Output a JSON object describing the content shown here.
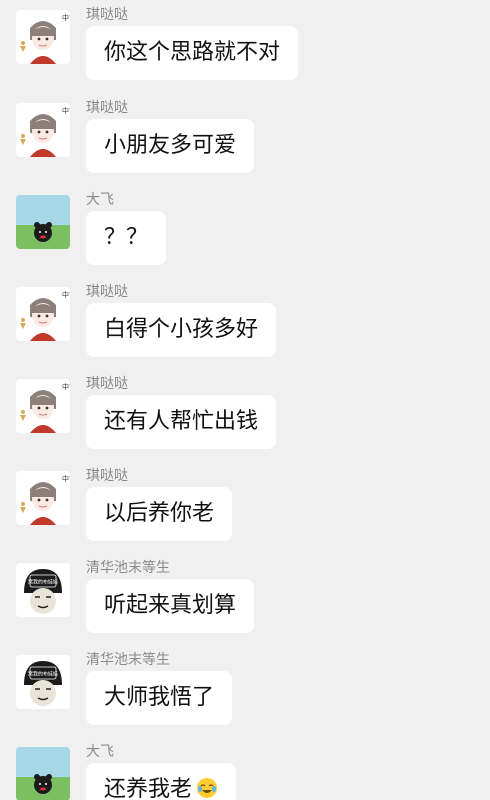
{
  "messages": [
    {
      "sender": "琪哒哒",
      "text": "你这个思路就不对",
      "avatar": "qi-avatar"
    },
    {
      "sender": "琪哒哒",
      "text": "小朋友多可爱",
      "avatar": "qi-avatar"
    },
    {
      "sender": "大飞",
      "text": "？？",
      "avatar": "dafei-avatar"
    },
    {
      "sender": "琪哒哒",
      "text": "白得个小孩多好",
      "avatar": "qi-avatar"
    },
    {
      "sender": "琪哒哒",
      "text": "还有人帮忙出钱",
      "avatar": "qi-avatar"
    },
    {
      "sender": "琪哒哒",
      "text": "以后养你老",
      "avatar": "qi-avatar"
    },
    {
      "sender": "清华池末等生",
      "text": "听起来真划算",
      "avatar": "meme-avatar"
    },
    {
      "sender": "清华池末等生",
      "text": "大师我悟了",
      "avatar": "meme-avatar"
    },
    {
      "sender": "大飞",
      "text": "还养我老",
      "avatar": "dafei-avatar",
      "emoji": "laugh-cry-emoji"
    }
  ],
  "avatar_text": {
    "qi_side": "中吉",
    "meme_badge": "窝我的布娃娃"
  }
}
